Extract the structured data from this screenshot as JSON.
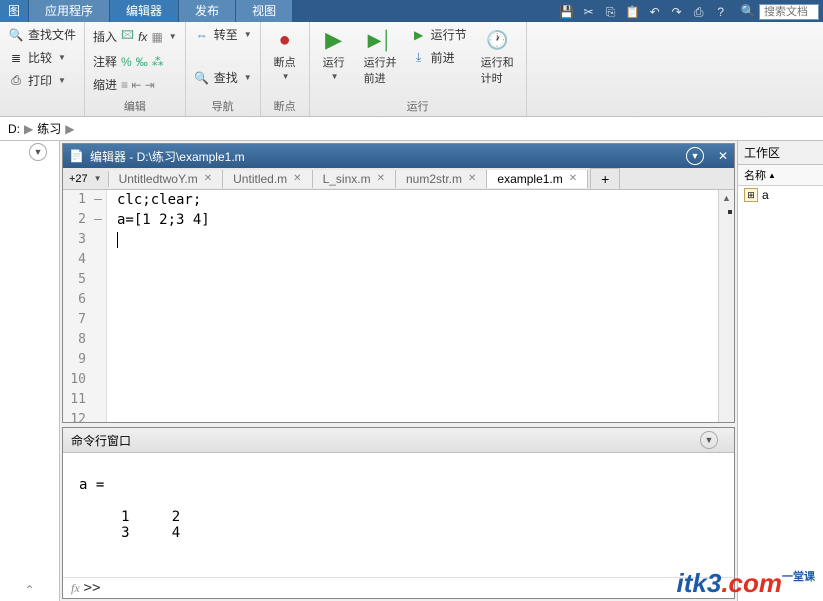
{
  "main_tabs": {
    "items": [
      "图",
      "应用程序",
      "编辑器",
      "发布",
      "视图"
    ],
    "active_index": 2
  },
  "top_search_placeholder": "搜索文档",
  "ribbon": {
    "groups": [
      {
        "label": "",
        "items": [
          {
            "label": "查找文件",
            "icon": "search-file"
          },
          {
            "label": "比较",
            "icon": "compare",
            "dropdown": true
          },
          {
            "label": "打印",
            "icon": "print",
            "dropdown": true
          }
        ]
      },
      {
        "label": "编辑",
        "items": [
          {
            "label": "插入",
            "dropdown": true
          },
          {
            "label": "注释",
            "sub": "%"
          },
          {
            "label": "缩进",
            "sub": "≡"
          }
        ]
      },
      {
        "label": "导航",
        "big": [
          {
            "label": "转至",
            "icon": "goto",
            "dropdown": true
          }
        ],
        "items": [
          {
            "label": "查找",
            "icon": "find",
            "dropdown": true
          }
        ]
      },
      {
        "label": "断点",
        "big": [
          {
            "label": "断点",
            "icon": "breakpoint",
            "dropdown": true
          }
        ]
      },
      {
        "label": "运行",
        "big": [
          {
            "label": "运行",
            "icon": "run",
            "dropdown": true
          },
          {
            "label": "运行并\n前进",
            "icon": "run-advance"
          },
          {
            "label": "运行节",
            "icon": "run-section",
            "small": true
          },
          {
            "label": "前进",
            "icon": "advance",
            "small": true
          },
          {
            "label": "运行和\n计时",
            "icon": "run-time"
          }
        ]
      }
    ]
  },
  "address": {
    "drive": "D:",
    "folder": "练习"
  },
  "editor": {
    "title": "编辑器 - D:\\练习\\example1.m",
    "tab_btn": "+27",
    "tabs": [
      {
        "label": "UntitledtwoY.m"
      },
      {
        "label": "Untitled.m"
      },
      {
        "label": "L_sinx.m"
      },
      {
        "label": "num2str.m"
      },
      {
        "label": "example1.m",
        "active": true
      }
    ],
    "lines": [
      {
        "num": 1,
        "dash": true,
        "code": "clc;clear;"
      },
      {
        "num": 2,
        "dash": true,
        "code": "a=[1 2;3 4]"
      },
      {
        "num": 3,
        "dash": false,
        "code": ""
      },
      {
        "num": 4,
        "dash": false,
        "code": ""
      },
      {
        "num": 5,
        "dash": false,
        "code": ""
      },
      {
        "num": 6,
        "dash": false,
        "code": ""
      },
      {
        "num": 7,
        "dash": false,
        "code": ""
      },
      {
        "num": 8,
        "dash": false,
        "code": ""
      },
      {
        "num": 9,
        "dash": false,
        "code": ""
      },
      {
        "num": 10,
        "dash": false,
        "code": ""
      },
      {
        "num": 11,
        "dash": false,
        "code": ""
      },
      {
        "num": 12,
        "dash": false,
        "code": ""
      }
    ]
  },
  "cmd": {
    "title": "命令行窗口",
    "output": "\na =\n\n     1     2\n     3     4\n",
    "prompt": ">>"
  },
  "workspace": {
    "title": "工作区",
    "col": "名称",
    "items": [
      {
        "name": "a"
      }
    ]
  },
  "watermark": {
    "t1": "itk3",
    "t2": ".com",
    "t3": "一堂课"
  }
}
